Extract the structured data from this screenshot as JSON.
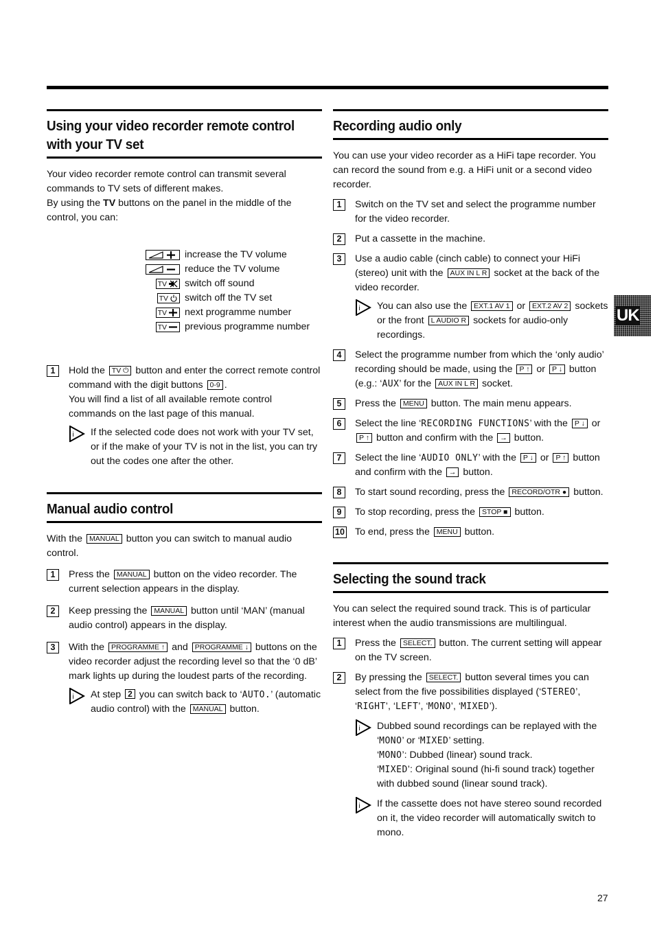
{
  "page_number": "27",
  "language_tab": "UK",
  "left": {
    "remote": {
      "title_line1": "Using your video recorder remote control",
      "title_line2": "with your TV set",
      "intro1": "Your video recorder remote control can transmit several commands to TV sets of different makes.",
      "intro2_pre": "By using the ",
      "intro2_bold": "TV",
      "intro2_post": " buttons on the panel in the middle of the control, you can:",
      "tv_buttons": [
        {
          "icon": "volume-up-icon",
          "key": "◿+",
          "label": "increase the TV volume"
        },
        {
          "icon": "volume-down-icon",
          "key": "◿−",
          "label": "reduce the TV volume"
        },
        {
          "icon": "mute-icon",
          "key": "TV 🕨̸",
          "label": "switch off sound"
        },
        {
          "icon": "power-icon",
          "key": "TV ⏻",
          "label": "switch off the TV set"
        },
        {
          "icon": "channel-up-icon",
          "key": "TV +",
          "label": "next programme number"
        },
        {
          "icon": "channel-down-icon",
          "key": "TV −",
          "label": "previous programme number"
        }
      ],
      "step1": {
        "num": "1",
        "a": "Hold the",
        "key1": "TV ⏻",
        "b": "button and enter the correct remote control command with the digit buttons",
        "key2": "0-9",
        "c": ".",
        "d": "You will find a list of all available remote control commands on the last page of this manual."
      },
      "note1": "If the selected code does not work with your TV set, or if the make of your TV is not in the list, you can try out the codes one after the other."
    },
    "manual": {
      "title": "Manual audio control",
      "intro_a": "With the",
      "intro_key": "MANUAL",
      "intro_b": "button you can switch to manual audio control.",
      "step1": {
        "num": "1",
        "a": "Press the",
        "key": "MANUAL",
        "b": "button on the video recorder. The current selection appears in the display."
      },
      "step2": {
        "num": "2",
        "a": "Keep pressing the",
        "key": "MANUAL",
        "b": "button until ‘MAN’ (manual audio control) appears in the display."
      },
      "step3": {
        "num": "3",
        "a": "With the",
        "key1": "PROGRAMME ↑",
        "b": "and",
        "key2": "PROGRAMME ↓",
        "c": "buttons on the video recorder adjust the recording level so that the ‘0 dB’ mark lights up during the loudest parts of the recording."
      },
      "note": {
        "a": "At step",
        "num": "2",
        "b": "you can switch back to ‘",
        "mono": "AUTO.",
        "c": "’ (automatic audio control) with the",
        "key": "MANUAL",
        "d": "button."
      }
    }
  },
  "right": {
    "recording": {
      "title": "Recording audio only",
      "intro": "You can use your video recorder as a HiFi tape recorder. You can record the sound from e.g. a HiFi unit or a second video recorder.",
      "step1": {
        "num": "1",
        "text": "Switch on the TV set and select the programme number for the video recorder."
      },
      "step2": {
        "num": "2",
        "text": "Put a cassette in the machine."
      },
      "step3": {
        "num": "3",
        "a": "Use a audio cable (cinch cable) to connect your HiFi (stereo) unit with the",
        "key": "AUX IN L R",
        "b": "socket at the back of the video recorder."
      },
      "note": {
        "a": "You can also use the",
        "key1": "EXT.1 AV 1",
        "b": "or",
        "key2": "EXT.2 AV 2",
        "c": "sockets or the front",
        "key3": "L AUDIO R",
        "d": "sockets for audio-only recordings."
      },
      "step4": {
        "num": "4",
        "a": "Select the programme number from which the ‘only audio’ recording should be made, using the",
        "key1": "P ↑",
        "b": "or",
        "key2": "P ↓",
        "c": "button (e.g.: ‘",
        "mono": "AUX",
        "d": "’ for the",
        "key3": "AUX IN L R",
        "e": "socket."
      },
      "step5": {
        "num": "5",
        "a": "Press the",
        "key": "MENU",
        "b": "button. The main menu appears."
      },
      "step6": {
        "num": "6",
        "a": "Select the line ‘",
        "mono": "RECORDING FUNCTIONS",
        "b": "’ with the",
        "key1": "P ↓",
        "c": "or",
        "key2": "P ↑",
        "d": "button and confirm with the",
        "key3": "→",
        "e": "button."
      },
      "step7": {
        "num": "7",
        "a": "Select the line ‘",
        "mono": "AUDIO ONLY",
        "b": "’ with the",
        "key1": "P ↓",
        "c": "or",
        "key2": "P ↑",
        "d": "button and confirm with the",
        "key3": "→",
        "e": "button."
      },
      "step8": {
        "num": "8",
        "a": "To start sound recording, press the",
        "key": "RECORD/OTR ●",
        "b": "button."
      },
      "step9": {
        "num": "9",
        "a": "To stop recording, press the",
        "key": "STOP ■",
        "b": "button."
      },
      "step10": {
        "num": "10",
        "a": "To end, press the",
        "key": "MENU",
        "b": "button."
      }
    },
    "soundtrack": {
      "title": "Selecting the sound track",
      "intro": "You can select the required sound track. This is of particular interest when the audio transmissions are multilingual.",
      "step1": {
        "num": "1",
        "a": "Press the",
        "key": "SELECT.",
        "b": "button. The current setting will appear on the TV screen."
      },
      "step2": {
        "num": "2",
        "a": "By pressing the",
        "key": "SELECT.",
        "b": "button several times you can select from the five possibilities displayed (‘",
        "m1": "STEREO",
        "s1": "’, ‘",
        "m2": "RIGHT",
        "s2": "’, ‘",
        "m3": "LEFT",
        "s3": "’, ‘",
        "m4": "MONO",
        "s4": "’, ‘",
        "m5": "MIXED",
        "s5": "’)."
      },
      "note1": {
        "a": "Dubbed sound recordings can be replayed with the ‘",
        "m1": "MONO",
        "b": "’ or ‘",
        "m2": "MIXED",
        "c": "’ setting.",
        "d_pre": "‘",
        "m3": "MONO",
        "d": "’: Dubbed (linear) sound track.",
        "e_pre": "‘",
        "m4": "MIXED",
        "e": "’: Original sound (hi-fi sound track) together with dubbed sound (linear sound track)."
      },
      "note2": "If the cassette does not have stereo sound recorded on it, the video recorder will automatically switch to mono."
    }
  }
}
